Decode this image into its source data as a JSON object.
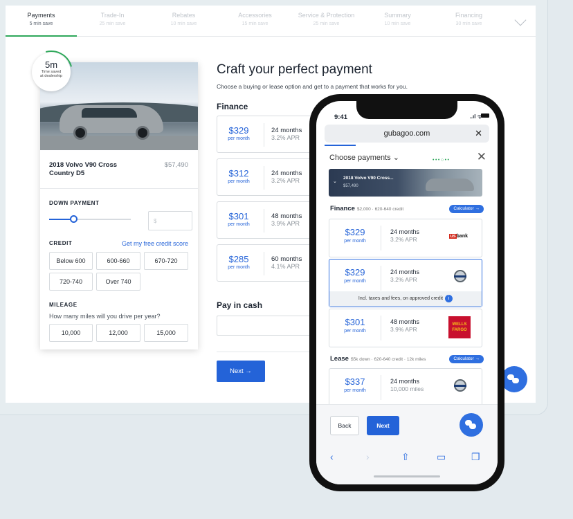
{
  "steps": [
    {
      "title": "Payments",
      "sub": "5 min save"
    },
    {
      "title": "Trade-In",
      "sub": "25 min save"
    },
    {
      "title": "Rebates",
      "sub": "10 min save"
    },
    {
      "title": "Accessories",
      "sub": "15 min save"
    },
    {
      "title": "Service & Protection",
      "sub": "25 min save"
    },
    {
      "title": "Summary",
      "sub": "10 min save"
    },
    {
      "title": "Financing",
      "sub": "30 min save"
    }
  ],
  "timer": {
    "value": "5m",
    "label_1": "Time saved",
    "label_2": "at dealership"
  },
  "car": {
    "title_1": "2018 Volvo V90 Cross",
    "title_2": "Country D5",
    "price": "$57,490"
  },
  "down_payment": {
    "label": "DOWN PAYMENT",
    "placeholder": "$",
    "level": 0.3
  },
  "credit": {
    "label": "CREDIT",
    "link": "Get my free credit score",
    "options": [
      "Below 600",
      "600-660",
      "670-720",
      "720-740",
      "Over 740"
    ]
  },
  "mileage": {
    "label": "MILEAGE",
    "question": "How many miles will you drive per year?",
    "options": [
      "10,000",
      "12,000",
      "15,000"
    ]
  },
  "main": {
    "heading": "Craft your perfect payment",
    "subheading": "Choose a buying or lease option and get to a payment that works for you.",
    "finance_label": "Finance",
    "cash_label": "Pay in cash",
    "next": "Next →"
  },
  "finance_options": [
    {
      "amount": "$329",
      "per": "per month",
      "months": "24 months",
      "apr": "3.2% APR"
    },
    {
      "amount": "$312",
      "per": "per month",
      "months": "24 months",
      "apr": "3.2% APR"
    },
    {
      "amount": "$301",
      "per": "per month",
      "months": "48 months",
      "apr": "3.9% APR"
    },
    {
      "amount": "$285",
      "per": "per month",
      "months": "60 months",
      "apr": "4.1% APR"
    }
  ],
  "phone": {
    "time": "9:41",
    "signal": "..ıl ᯤ",
    "url": "gubagoo.com",
    "url_close": "✕",
    "choose": "Choose payments ⌄",
    "close": "✕",
    "car_title": "2018 Volvo V90 Cross...",
    "car_price": "$57,490",
    "finance_label": "Finance",
    "finance_meta": "$2,000 · 620-640 credit",
    "calculator": "Calculator →",
    "lease_label": "Lease",
    "lease_meta": "$5k down · 620-640 credit · 12k miles",
    "note": "Incl. taxes and fees, on approved credit",
    "info": "i",
    "back": "Back",
    "next": "Next",
    "usbank_logo": "bank",
    "wf_logo_1": "WELLS",
    "wf_logo_2": "FARGO",
    "options": [
      {
        "amount": "$329",
        "per": "per month",
        "months": "24 months",
        "apr": "3.2% APR"
      },
      {
        "amount": "$329",
        "per": "per month",
        "months": "24 months",
        "apr": "3.2% APR"
      },
      {
        "amount": "$301",
        "per": "per month",
        "months": "48 months",
        "apr": "3.9% APR"
      }
    ],
    "lease_option": {
      "amount": "$337",
      "per": "per month",
      "months": "24 months",
      "apr": "10,000 miles"
    }
  },
  "icons": [
    "chevron-down-icon",
    "chat-icon",
    "close-icon",
    "share-icon",
    "book-icon",
    "tabs-icon",
    "back-arrow-icon",
    "forward-arrow-icon",
    "info-icon"
  ],
  "colors": {
    "accent": "#2463d8",
    "progress": "#2ea85a",
    "chat": "#2f6fe0"
  }
}
